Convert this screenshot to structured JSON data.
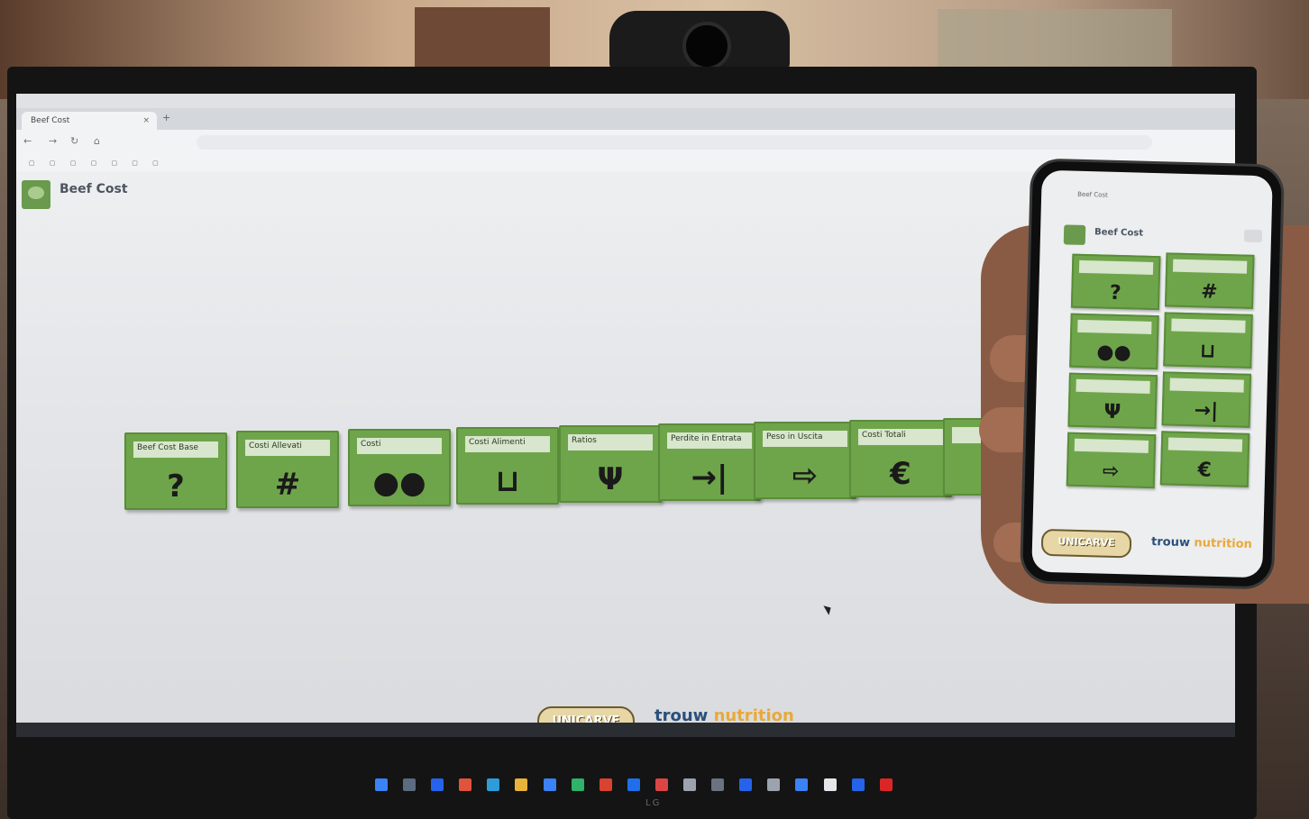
{
  "browser": {
    "tab_title": "Beef Cost",
    "tab_close": "×",
    "tab_add": "+"
  },
  "app": {
    "title": "Beef Cost"
  },
  "tiles": [
    {
      "label": "Beef Cost Base",
      "icon": "?"
    },
    {
      "label": "Costi Allevati",
      "icon": "#"
    },
    {
      "label": "Costi",
      "icon": "●●"
    },
    {
      "label": "Costi Alimenti",
      "icon": "⊔"
    },
    {
      "label": "Ratios",
      "icon": "Ψ"
    },
    {
      "label": "Perdite in Entrata",
      "icon": "→|"
    },
    {
      "label": "Peso in Uscita",
      "icon": "⇨"
    },
    {
      "label": "Costi Totali",
      "icon": "€"
    },
    {
      "label": "",
      "icon": "≡"
    }
  ],
  "phone": {
    "page_title": "Beef Cost",
    "url_line1": "Beef Cost",
    "tiles": [
      {
        "label": "",
        "icon": "?"
      },
      {
        "label": "",
        "icon": "#"
      },
      {
        "label": "",
        "icon": "●●"
      },
      {
        "label": "",
        "icon": "⊔"
      },
      {
        "label": "",
        "icon": "Ψ"
      },
      {
        "label": "",
        "icon": "→|"
      },
      {
        "label": "",
        "icon": "⇨"
      },
      {
        "label": "",
        "icon": "€"
      }
    ]
  },
  "footer": {
    "logo_left": "UNICARVE",
    "logo_right_a": "trouw",
    "logo_right_b": "nutrition"
  },
  "monitor_brand": "LG"
}
